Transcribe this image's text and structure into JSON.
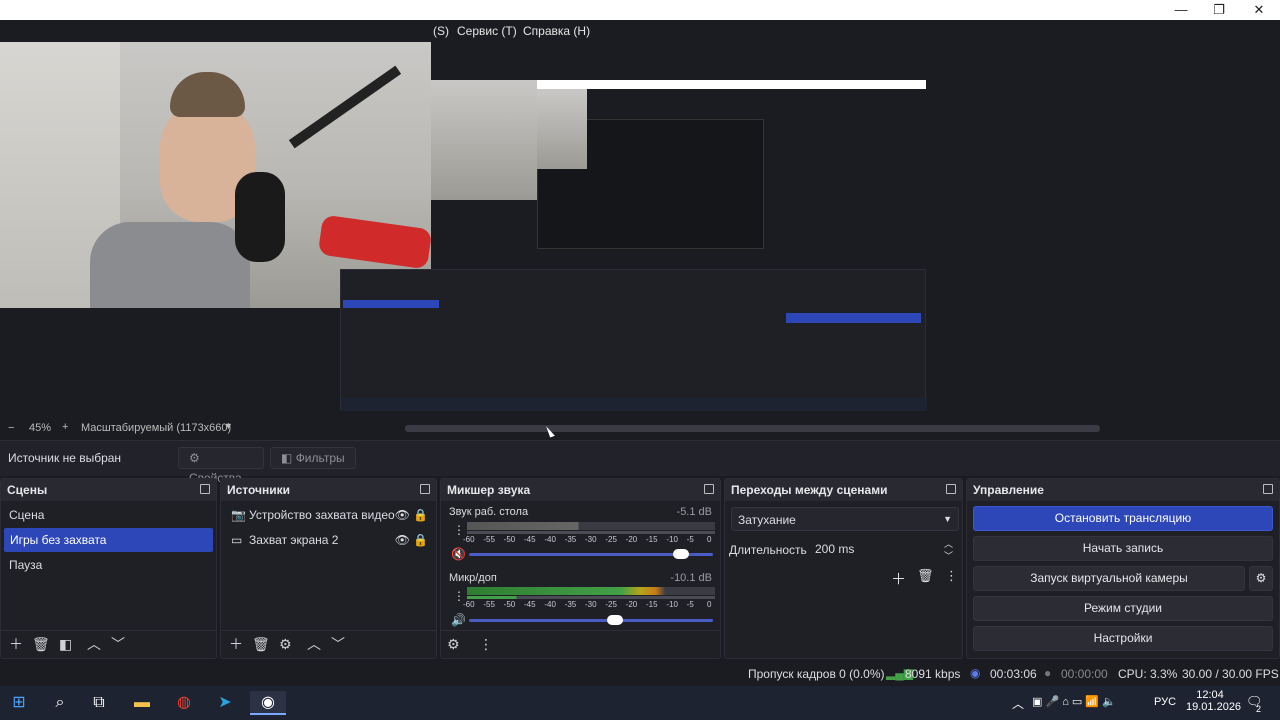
{
  "window": {
    "minimize": "—",
    "restore": "❐",
    "close": "✕"
  },
  "menu": {
    "items_partial": "(S)",
    "service": "Сервис (T)",
    "help": "Справка (H)"
  },
  "preview": {
    "zoom_minus": "−",
    "zoom_value": "45%",
    "zoom_plus": "+",
    "scale_mode": "Масштабируемый (1173x660)"
  },
  "source_toolbar": {
    "no_source": "Источник не выбран",
    "properties": "Свойства",
    "filters": "Фильтры"
  },
  "scenes": {
    "title": "Сцены",
    "items": [
      "Сцена",
      "Игры без захвата",
      "Пауза"
    ],
    "selected_index": 1
  },
  "sources": {
    "title": "Источники",
    "items": [
      "Устройство захвата видео",
      "Захват экрана 2"
    ]
  },
  "mixer": {
    "title": "Микшер звука",
    "channels": [
      {
        "name": "Звук раб. стола",
        "db": "-5.1 dB",
        "volume": 0.87,
        "muted": true
      },
      {
        "name": "Микр/доп",
        "db": "-10.1 dB",
        "volume": 0.6,
        "muted": false
      }
    ],
    "ticks": [
      "-60",
      "-55",
      "-50",
      "-45",
      "-40",
      "-35",
      "-30",
      "-25",
      "-20",
      "-15",
      "-10",
      "-5",
      "0"
    ]
  },
  "transitions": {
    "title": "Переходы между сценами",
    "selected": "Затухание",
    "duration_label": "Длительность",
    "duration_value": "200 ms"
  },
  "controls": {
    "title": "Управление",
    "stop_stream": "Остановить трансляцию",
    "start_record": "Начать запись",
    "virtual_cam": "Запуск виртуальной камеры",
    "studio_mode": "Режим студии",
    "settings": "Настройки"
  },
  "status": {
    "dropped": "Пропуск кадров 0 (0.0%)",
    "bitrate": "8091 kbps",
    "stream_time": "00:03:06",
    "record_time": "00:00:00",
    "cpu": "CPU: 3.3%",
    "fps": "30.00 / 30.00 FPS"
  },
  "taskbar": {
    "lang": "РУС",
    "time": "12:04",
    "date": "19.01.2026",
    "notif_count": "2"
  },
  "colors": {
    "accent": "#2d47b8",
    "bg": "#1b1c22",
    "dock": "#1f2026"
  }
}
